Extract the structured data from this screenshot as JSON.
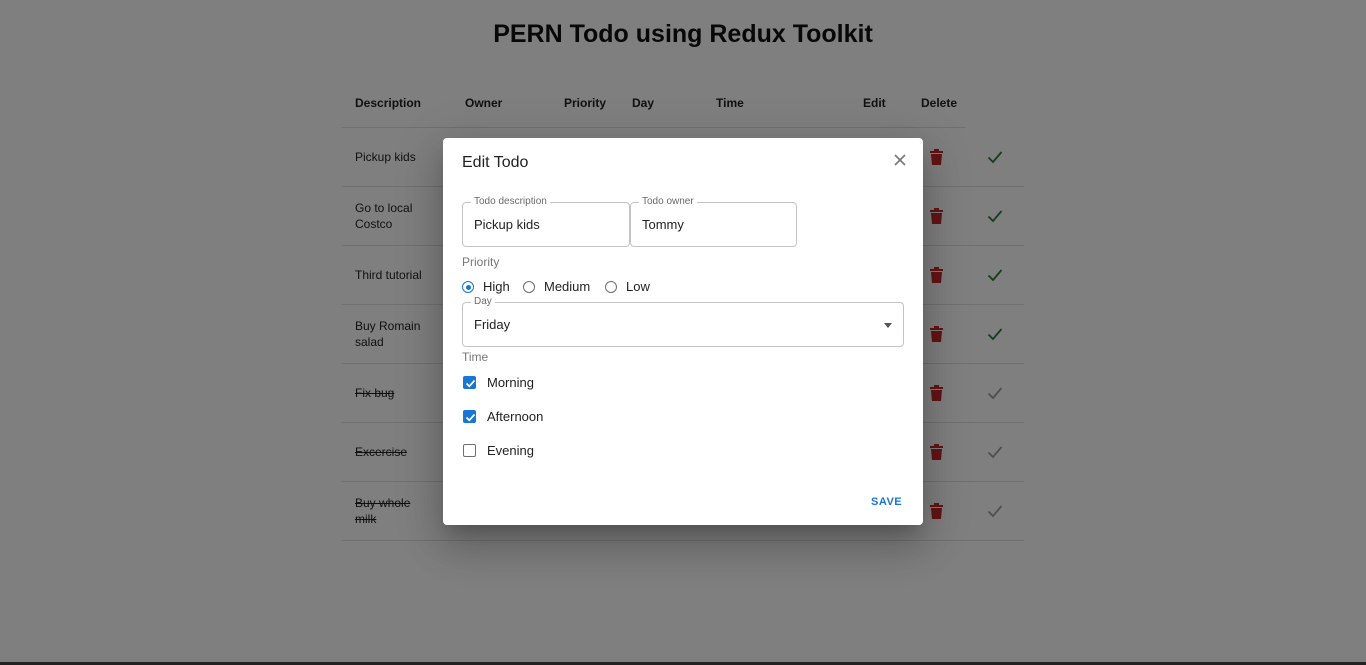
{
  "page": {
    "title": "PERN Todo using Redux Toolkit"
  },
  "table": {
    "headers": [
      "Description",
      "Owner",
      "Priority",
      "Day",
      "Time",
      "Edit",
      "Delete"
    ],
    "rows": [
      {
        "description": "Pickup kids",
        "completed": false
      },
      {
        "description": "Go to local Costco",
        "completed": false
      },
      {
        "description": "Third tutorial",
        "completed": false
      },
      {
        "description": "Buy Romain salad",
        "completed": false
      },
      {
        "description": "Fix bug",
        "completed": true
      },
      {
        "description": "Excercise",
        "completed": true
      },
      {
        "description": "Buy whole milk",
        "completed": true
      }
    ]
  },
  "dialog": {
    "title": "Edit Todo",
    "description_field": {
      "label": "Todo description",
      "value": "Pickup kids"
    },
    "owner_field": {
      "label": "Todo owner",
      "value": "Tommy"
    },
    "priority": {
      "label": "Priority",
      "options": [
        "High",
        "Medium",
        "Low"
      ],
      "selected": "High"
    },
    "day_field": {
      "label": "Day",
      "value": "Friday"
    },
    "time": {
      "label": "Time",
      "options": [
        {
          "label": "Morning",
          "checked": true
        },
        {
          "label": "Afternoon",
          "checked": true
        },
        {
          "label": "Evening",
          "checked": false
        }
      ]
    },
    "save_label": "SAVE"
  },
  "colors": {
    "accent": "#1976d2",
    "delete_icon": "#c62828",
    "check_active": "#2e7d32",
    "check_done": "#9e9e9e"
  }
}
